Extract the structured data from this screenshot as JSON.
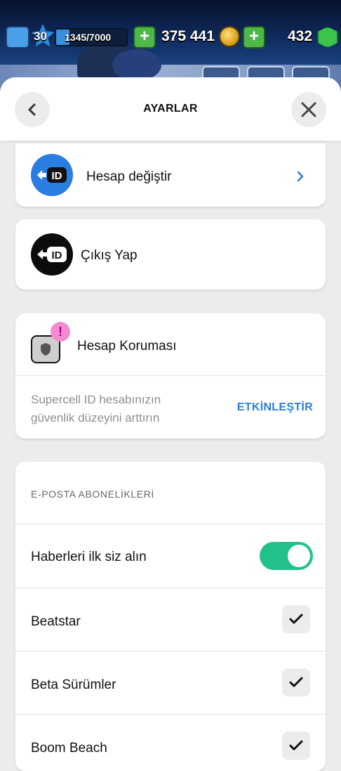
{
  "hud": {
    "level": "30",
    "xp": "1345/7000",
    "xp_progress": 0.19,
    "coins": "375 441",
    "gems": "432"
  },
  "header": {
    "title": "AYARLAR"
  },
  "account": {
    "switch_label": "Hesap değiştir",
    "logout_label": "Çıkış Yap",
    "id_icon_text": "ID"
  },
  "protection": {
    "title": "Hesap Koruması",
    "badge": "!",
    "description_line1": "Supercell ID hesabınızın",
    "description_line2": "güvenlik düzeyini arttırın",
    "action": "ETKİNLEŞTİR"
  },
  "subscriptions": {
    "header": "E-POSTA ABONELİKLERİ",
    "news_label": "Haberleri ilk siz alın",
    "news_enabled": true,
    "items": [
      {
        "label": "Beatstar",
        "checked": true
      },
      {
        "label": "Beta Sürümler",
        "checked": true
      },
      {
        "label": "Boom Beach",
        "checked": true
      }
    ]
  },
  "colors": {
    "accent_blue": "#2a7de1",
    "toggle_on": "#22c08a",
    "badge_pink": "#f58ad2"
  }
}
